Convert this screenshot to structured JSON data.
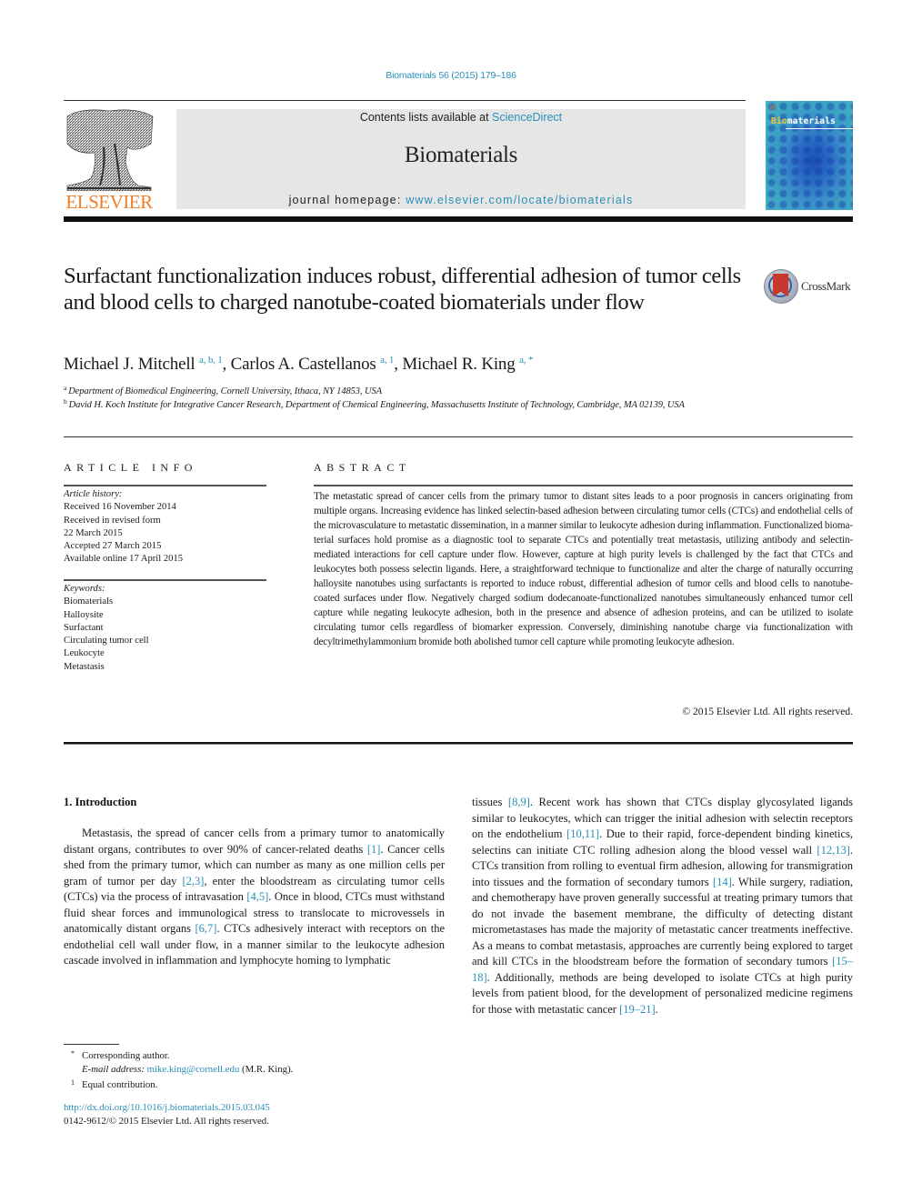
{
  "header": {
    "journal_ref": "Biomaterials 56 (2015) 179–186",
    "publisher_logo_text": "ELSEVIER",
    "contents_prefix": "Contents lists available at ",
    "contents_link": "ScienceDirect",
    "journal_name": "Biomaterials",
    "homepage_prefix": "journal homepage: ",
    "homepage_link": "www.elsevier.com/locate/biomaterials",
    "cover_title_highlight": "Bio",
    "cover_title_rest": "materials"
  },
  "article": {
    "title": "Surfactant functionalization induces robust, differential adhesion of tumor cells and blood cells to charged nanotube-coated biomaterials under flow",
    "crossmark_label": "CrossMark",
    "authors": [
      {
        "name": "Michael J. Mitchell",
        "sup": "a, b, 1",
        "sep": ", "
      },
      {
        "name": "Carlos A. Castellanos",
        "sup": "a, 1",
        "sep": ", "
      },
      {
        "name": "Michael R. King",
        "sup": "a, *",
        "sep": ""
      }
    ],
    "affiliations": [
      {
        "mark": "a",
        "text": "Department of Biomedical Engineering, Cornell University, Ithaca, NY 14853, USA"
      },
      {
        "mark": "b",
        "text": "David H. Koch Institute for Integrative Cancer Research, Department of Chemical Engineering, Massachusetts Institute of Technology, Cambridge, MA 02139, USA"
      }
    ]
  },
  "article_info": {
    "heading": "ARTICLE INFO",
    "history_label": "Article history:",
    "history": [
      "Received 16 November 2014",
      "Received in revised form",
      "22 March 2015",
      "Accepted 27 March 2015",
      "Available online 17 April 2015"
    ],
    "keywords_label": "Keywords:",
    "keywords": [
      "Biomaterials",
      "Halloysite",
      "Surfactant",
      "Circulating tumor cell",
      "Leukocyte",
      "Metastasis"
    ]
  },
  "abstract": {
    "heading": "ABSTRACT",
    "text": "The metastatic spread of cancer cells from the primary tumor to distant sites leads to a poor prognosis in cancers originating from multiple organs. Increasing evidence has linked selectin-based adhesion be­tween circulating tumor cells (CTCs) and endothelial cells of the microvasculature to metastatic dissemination, in a manner similar to leukocyte adhesion during inflammation. Functionalized bioma­terial surfaces hold promise as a diagnostic tool to separate CTCs and potentially treat metastasis, uti­lizing antibody and selectin-mediated interactions for cell capture under flow. However, capture at high purity levels is challenged by the fact that CTCs and leukocytes both possess selectin ligands. Here, a straightforward technique to functionalize and alter the charge of naturally occurring halloysite nano­tubes using surfactants is reported to induce robust, differential adhesion of tumor cells and blood cells to nanotube-coated surfaces under flow. Negatively charged sodium dodecanoate-functionalized nano­tubes simultaneously enhanced tumor cell capture while negating leukocyte adhesion, both in the presence and absence of adhesion proteins, and can be utilized to isolate circulating tumor cells regardless of biomarker expression. Conversely, diminishing nanotube charge via functionalization with decyltrimethylammonium bromide both abolished tumor cell capture while promoting leukocyte adhesion.",
    "copyright": "© 2015 Elsevier Ltd. All rights reserved."
  },
  "body": {
    "section_heading": "1.  Introduction",
    "left_column": [
      {
        "t": "Metastasis, the spread of cancer cells from a primary tumor to anatomically distant organs, contributes to over 90% of cancer-related deaths "
      },
      {
        "ref": "[1]"
      },
      {
        "t": ". Cancer cells shed from the primary tumor, which can number as many as one million cells per gram of tumor per day "
      },
      {
        "ref": "[2,3]"
      },
      {
        "t": ", enter the bloodstream as circulating tumor cells (CTCs) via the process of intravasation "
      },
      {
        "ref": "[4,5]"
      },
      {
        "t": ". Once in blood, CTCs must withstand fluid shear forces and immunological stress to translocate to microvessels in anatomically distant organs "
      },
      {
        "ref": "[6,7]"
      },
      {
        "t": ". CTCs adhesively interact with receptors on the endothelial cell wall under flow, in a manner similar to the leukocyte adhesion cascade involved in inflammation and lymphocyte homing to lymphatic"
      }
    ],
    "right_column": [
      {
        "t": "tissues "
      },
      {
        "ref": "[8,9]"
      },
      {
        "t": ". Recent work has shown that CTCs display glycosy­lated ligands similar to leukocytes, which can trigger the initial adhesion with selectin receptors on the endothelium "
      },
      {
        "ref": "[10,11]"
      },
      {
        "t": ". Due to their rapid, force-dependent binding kinetics, selectins can initiate CTC rolling adhesion along the blood vessel wall "
      },
      {
        "ref": "[12,13]"
      },
      {
        "t": ". CTCs transition from rolling to eventual firm adhesion, allowing for transmigration into tissues and the formation of secondary tumors "
      },
      {
        "ref": "[14]"
      },
      {
        "t": ". While surgery, radiation, and chemotherapy have proven generally successful at treating primary tumors that do not invade the basement membrane, the difficulty of detecting distant micrometastases has made the majority of metastatic cancer treatments ineffective. As a means to combat metastasis, ap­proaches are currently being explored to target and kill CTCs in the bloodstream before the formation of secondary tumors "
      },
      {
        "ref": "[15–18]"
      },
      {
        "t": ". Additionally, methods are being developed to isolate CTCs at high purity levels from patient blood, for the development of person­alized medicine regimens for those with metastatic cancer "
      },
      {
        "ref": "[19–21]"
      },
      {
        "t": "."
      }
    ]
  },
  "footnotes": {
    "corresponding_mark": "*",
    "corresponding_text": "Corresponding author.",
    "email_label": "E-mail address: ",
    "email": "mike.king@cornell.edu",
    "email_suffix": " (M.R. King).",
    "equal_mark": "1",
    "equal_text": "Equal contribution.",
    "doi": "http://dx.doi.org/10.1016/j.biomaterials.2015.03.045",
    "issn_copyright": "0142-9612/© 2015 Elsevier Ltd. All rights reserved."
  },
  "colors": {
    "link": "#2a8fb8",
    "elsevier_orange": "#f07e26",
    "banner_gray": "#e6e6e6"
  }
}
